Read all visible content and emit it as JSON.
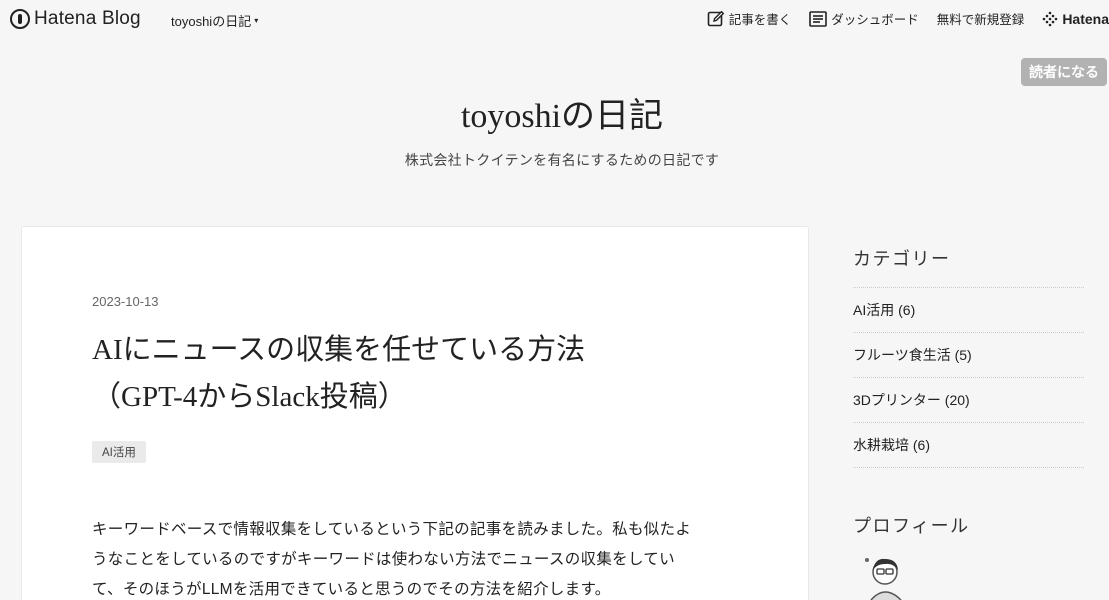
{
  "topbar": {
    "logo_text": "Hatena Blog",
    "blog_menu": "toyoshiの日記",
    "write_label": "記事を書く",
    "dashboard_label": "ダッシュボード",
    "signup_label": "無料で新規登録",
    "hatena_label": "Hatena"
  },
  "subscribe": "読者になる",
  "header": {
    "title": "toyoshiの日記",
    "description": "株式会社トクイテンを有名にするための日記です"
  },
  "entry": {
    "date": "2023-10-13",
    "title_line1": "AIにニュースの収集を任せている方法",
    "title_line2": "（GPT-4からSlack投稿）",
    "category": "AI活用",
    "body_line1": "キーワードベースで情報収集をしているという下記の記事を読みました。私も似たよ",
    "body_line2": "うなことをしているのですがキーワードは使わない方法でニュースの収集をしてい",
    "body_line3": "て、そのほうがLLMを活用できていると思うのでその方法を紹介します。"
  },
  "sidebar": {
    "category_heading": "カテゴリー",
    "categories": [
      {
        "label": "AI活用 (6)"
      },
      {
        "label": "フルーツ食生活 (5)"
      },
      {
        "label": "3Dプリンター (20)"
      },
      {
        "label": "水耕栽培 (6)"
      }
    ],
    "profile_heading": "プロフィール"
  }
}
